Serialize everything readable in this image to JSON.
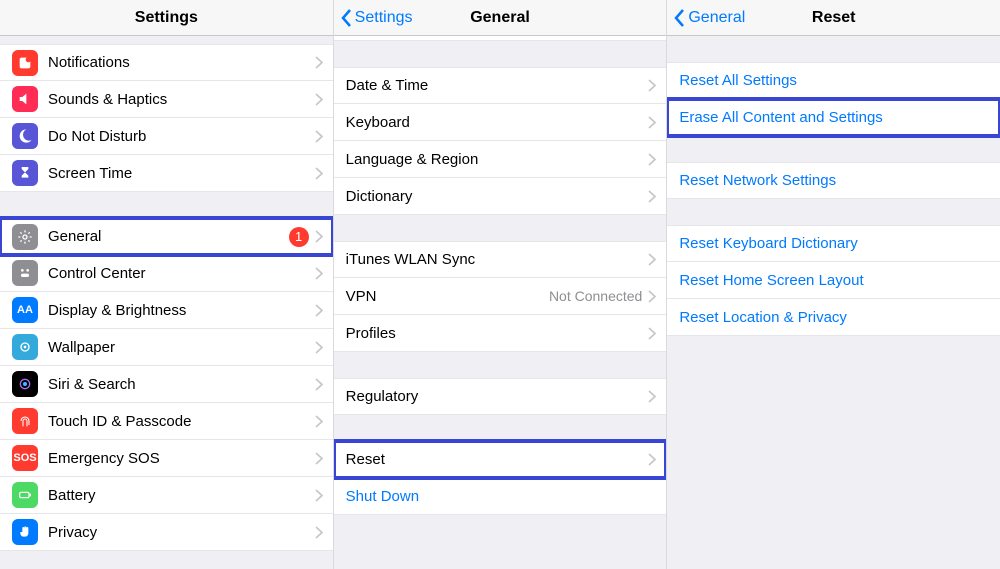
{
  "pane1": {
    "title": "Settings",
    "items": [
      {
        "label": "Notifications"
      },
      {
        "label": "Sounds & Haptics"
      },
      {
        "label": "Do Not Disturb"
      },
      {
        "label": "Screen Time"
      }
    ],
    "general": {
      "label": "General",
      "badge": "1"
    },
    "items2": [
      {
        "label": "Control Center"
      },
      {
        "label": "Display & Brightness"
      },
      {
        "label": "Wallpaper"
      },
      {
        "label": "Siri & Search"
      },
      {
        "label": "Touch ID & Passcode"
      },
      {
        "label": "Emergency SOS"
      },
      {
        "label": "Battery"
      },
      {
        "label": "Privacy"
      }
    ]
  },
  "pane2": {
    "back": "Settings",
    "title": "General",
    "group1": [
      {
        "label": "Date & Time"
      },
      {
        "label": "Keyboard"
      },
      {
        "label": "Language & Region"
      },
      {
        "label": "Dictionary"
      }
    ],
    "group2": [
      {
        "label": "iTunes WLAN Sync"
      },
      {
        "label": "VPN",
        "value": "Not Connected"
      },
      {
        "label": "Profiles"
      }
    ],
    "group3": [
      {
        "label": "Regulatory"
      }
    ],
    "reset": {
      "label": "Reset"
    },
    "shutdown": {
      "label": "Shut Down"
    }
  },
  "pane3": {
    "back": "General",
    "title": "Reset",
    "g1": [
      {
        "label": "Reset All Settings"
      }
    ],
    "erase": {
      "label": "Erase All Content and Settings"
    },
    "g2": [
      {
        "label": "Reset Network Settings"
      }
    ],
    "g3": [
      {
        "label": "Reset Keyboard Dictionary"
      },
      {
        "label": "Reset Home Screen Layout"
      },
      {
        "label": "Reset Location & Privacy"
      }
    ]
  }
}
